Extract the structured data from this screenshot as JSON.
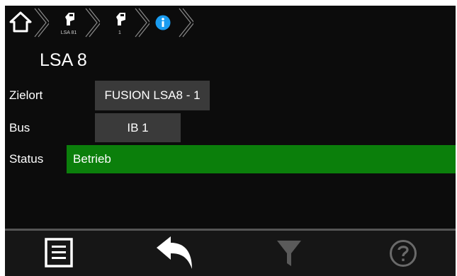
{
  "breadcrumb": {
    "items": [
      {
        "label": "",
        "icon": "home-icon"
      },
      {
        "label": "LSA 81",
        "icon": "device-icon"
      },
      {
        "label": "1",
        "icon": "device-icon"
      },
      {
        "label": "",
        "icon": "info-icon"
      }
    ]
  },
  "title": "LSA 8",
  "fields": {
    "zielort": {
      "label": "Zielort",
      "value": "FUSION LSA8 - 1"
    },
    "bus": {
      "label": "Bus",
      "value": "IB 1"
    },
    "status": {
      "label": "Status",
      "value": "Betrieb",
      "color": "#0b7f0b"
    }
  },
  "footer": {
    "buttons": [
      {
        "icon": "list-icon"
      },
      {
        "icon": "back-arrow-icon"
      },
      {
        "icon": "filter-icon",
        "disabled": true
      },
      {
        "icon": "help-icon",
        "disabled": true
      }
    ]
  },
  "colors": {
    "background": "#0c0c0c",
    "accent": "#1a9cf0",
    "status_ok": "#0b7f0b",
    "field_bg": "#3a3a3a"
  }
}
